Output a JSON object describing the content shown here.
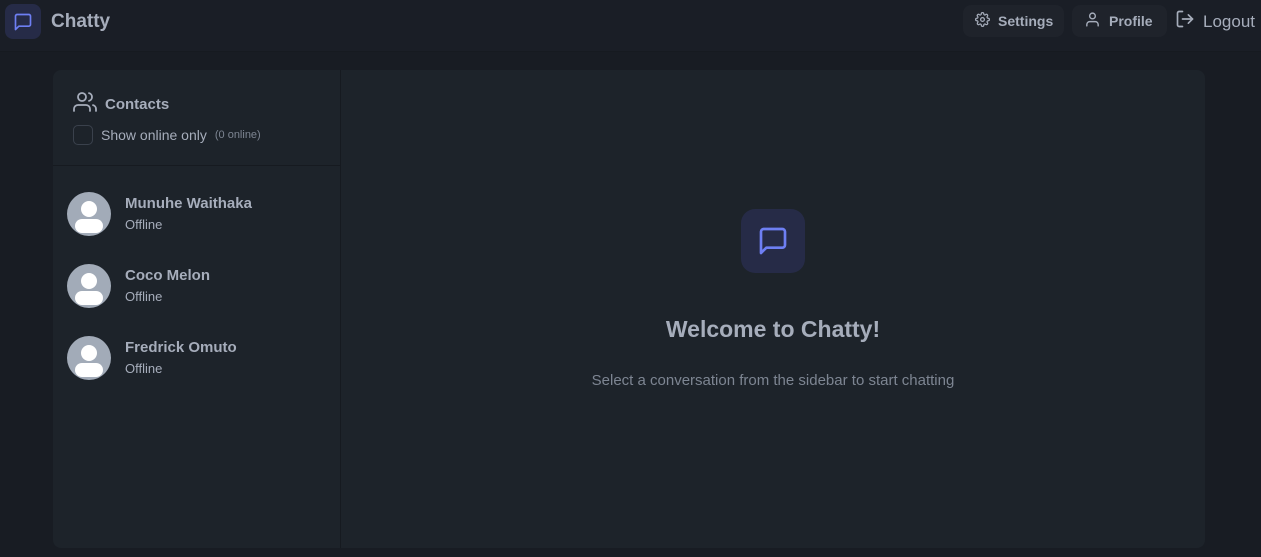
{
  "app": {
    "name": "Chatty",
    "accent": "#6e7ff3"
  },
  "nav": {
    "settings_label": "Settings",
    "profile_label": "Profile",
    "logout_label": "Logout"
  },
  "sidebar": {
    "title": "Contacts",
    "filter_label": "Show online only",
    "online_count": "(0 online)",
    "contacts": [
      {
        "name": "Munuhe Waithaka",
        "status": "Offline"
      },
      {
        "name": "Coco Melon",
        "status": "Offline"
      },
      {
        "name": "Fredrick Omuto",
        "status": "Offline"
      }
    ]
  },
  "main": {
    "welcome_title": "Welcome to Chatty!",
    "welcome_subtitle": "Select a conversation from the sidebar to start chatting"
  },
  "icons": [
    "message-square-icon",
    "gear-icon",
    "user-icon",
    "logout-icon",
    "users-icon",
    "avatar-placeholder-icon"
  ]
}
